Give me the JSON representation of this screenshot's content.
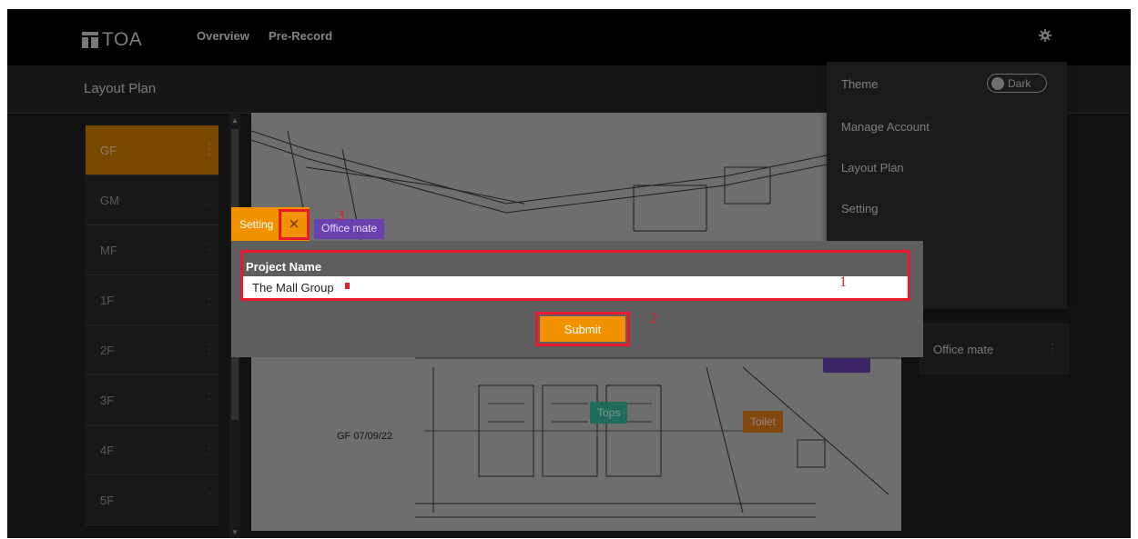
{
  "navbar": {
    "logo_text": "TOA",
    "links": [
      "Overview",
      "Pre-Record"
    ]
  },
  "page": {
    "title": "Layout Plan"
  },
  "floors": [
    "GF",
    "GM",
    "MF",
    "1F",
    "2F",
    "3F",
    "4F",
    "5F"
  ],
  "active_floor": "GF",
  "plan": {
    "caption": "GF 07/09/22",
    "tags": [
      {
        "label": "Office mate",
        "color": "#6a3fb0"
      },
      {
        "label": "Tops",
        "color": "#37b89a"
      },
      {
        "label": "Toilet",
        "color": "#e07a1a"
      }
    ]
  },
  "zone_card": {
    "label": "Office mate"
  },
  "menu": {
    "theme_label": "Theme",
    "theme_value": "Dark",
    "items": [
      "Manage Account",
      "Layout Plan",
      "Setting"
    ]
  },
  "dialog": {
    "tab_label": "Setting",
    "close_glyph": "×",
    "field_label": "Project Name",
    "field_value": "The Mall Group",
    "submit_label": "Submit"
  },
  "annotations": [
    "1",
    "2",
    "3"
  ],
  "colors": {
    "accent": "#f39200",
    "highlight": "#e8192c",
    "purple": "#6a3fb0"
  }
}
